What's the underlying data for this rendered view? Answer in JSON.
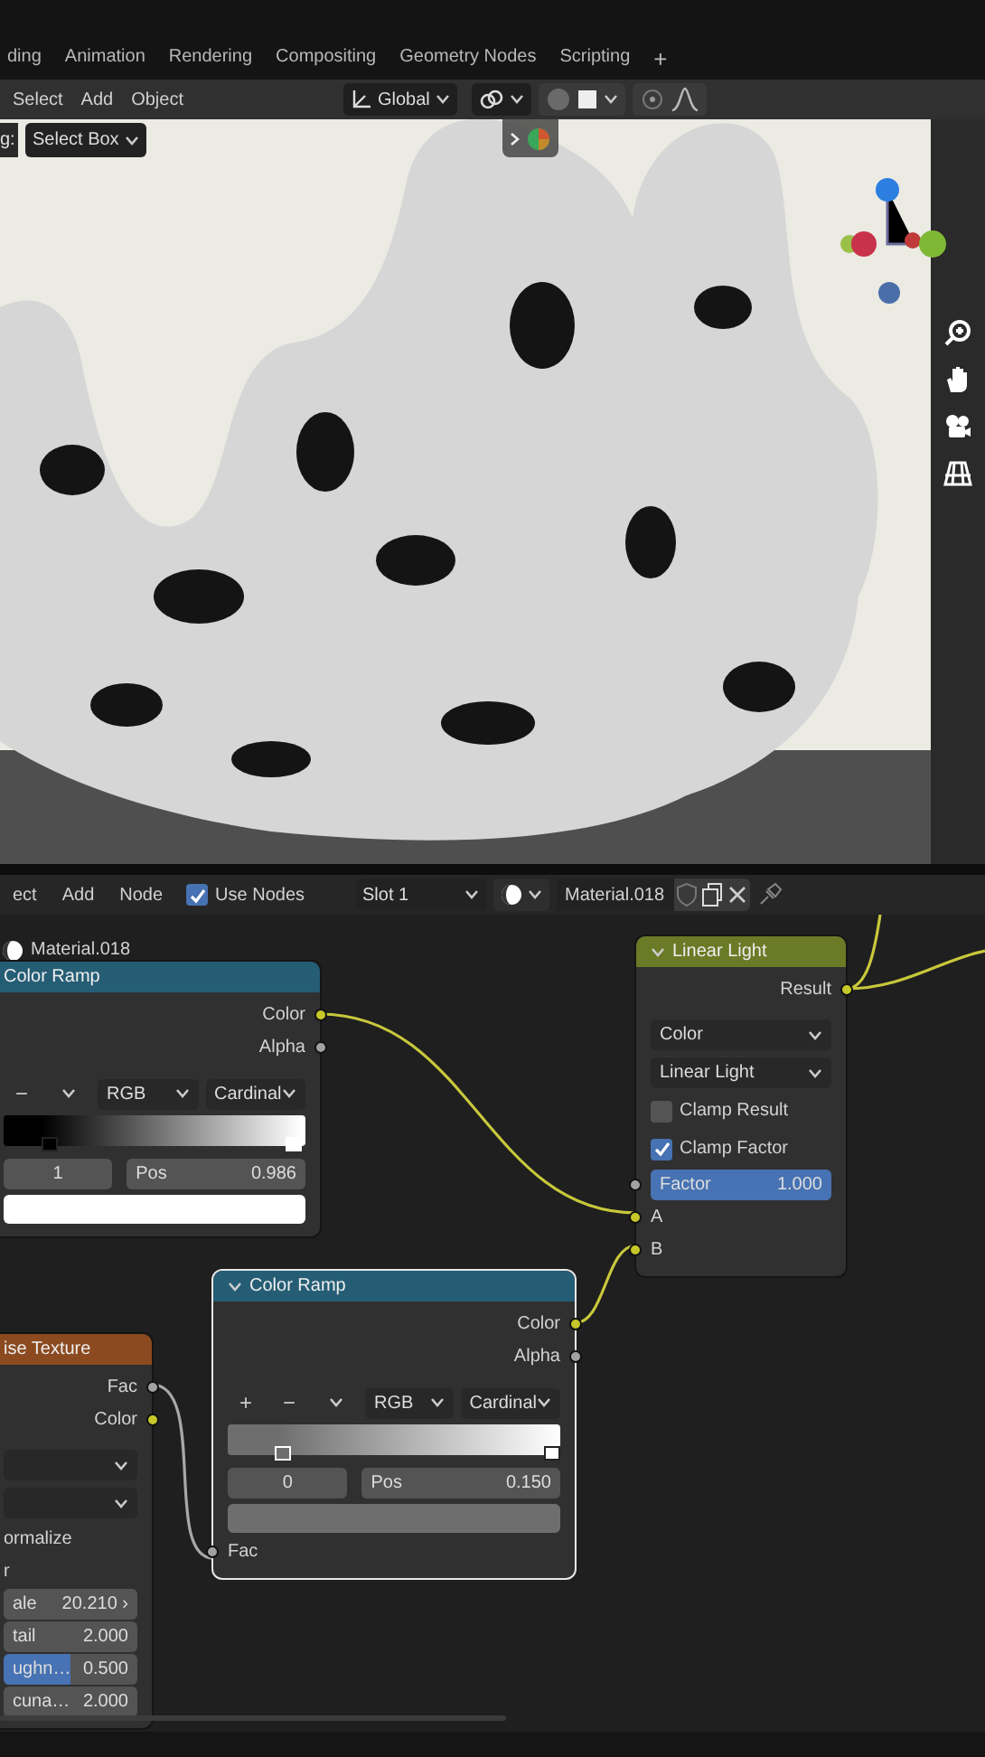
{
  "workspace_tabs": [
    {
      "label": "ding",
      "selected": false
    },
    {
      "label": "Animation",
      "selected": false
    },
    {
      "label": "Rendering",
      "selected": false
    },
    {
      "label": "Compositing",
      "selected": false
    },
    {
      "label": "Geometry Nodes",
      "selected": false
    },
    {
      "label": "Scripting",
      "selected": false
    }
  ],
  "add_tab": "+",
  "viewport": {
    "menus": [
      "Select",
      "Add",
      "Object"
    ],
    "orientation": "Global",
    "tool_label": "g:",
    "tool": "Select Box"
  },
  "node_editor": {
    "menus": [
      "ect",
      "Add",
      "Node"
    ],
    "use_nodes": {
      "label": "Use Nodes",
      "checked": true
    },
    "slot": "Slot 1",
    "material": "Material.018",
    "breadcrumb": "Material.018"
  },
  "nodes": [
    {
      "kind": "converter",
      "title": "Color Ramp",
      "rows": [
        {
          "kind": "output",
          "label": "Color",
          "color": "#c7c729"
        },
        {
          "kind": "output",
          "label": "Alpha",
          "color": "#a1a1a1"
        },
        {
          "kind": "ramp_controls",
          "signs": [
            "−"
          ],
          "mode": "RGB",
          "interpolation": "Cardinal"
        },
        {
          "kind": "ramp",
          "stops": [
            {
              "level": 0.13,
              "color": "#000000",
              "selected": false
            },
            {
              "level": 0.986,
              "color": "#ffffff",
              "selected": true
            }
          ]
        },
        {
          "kind": "stop_row",
          "index": "1",
          "label": "Pos",
          "value": "0.986"
        },
        {
          "kind": "swatch"
        }
      ]
    },
    {
      "kind": "mix",
      "title": "Linear Light",
      "expanded": true,
      "rows": [
        {
          "kind": "output",
          "label": "Result",
          "color": "#c7c729"
        },
        {
          "kind": "dropdown",
          "label": "Color"
        },
        {
          "kind": "dropdown",
          "label": "Linear Light"
        },
        {
          "kind": "checkbox",
          "label": "Clamp Result",
          "checked": false
        },
        {
          "kind": "checkbox",
          "label": "Clamp Factor",
          "checked": true
        },
        {
          "kind": "field",
          "label": "Factor",
          "value": "1.000",
          "level": 1,
          "color": "#a1a1a1"
        },
        {
          "kind": "input",
          "label": "A",
          "color": "#c7c729"
        },
        {
          "kind": "input",
          "label": "B",
          "color": "#c7c729"
        }
      ]
    },
    {
      "kind": "converter",
      "title": "Color Ramp",
      "expanded": true,
      "rows": [
        {
          "kind": "output",
          "label": "Color",
          "color": "#c7c729"
        },
        {
          "kind": "output",
          "label": "Alpha",
          "color": "#a1a1a1"
        },
        {
          "kind": "ramp_controls",
          "signs": [
            "+",
            "−"
          ],
          "mode": "RGB",
          "interpolation": "Cardinal"
        },
        {
          "kind": "ramp",
          "stops": [
            {
              "level": 0.15,
              "color": "#6e6e6e",
              "selected": true
            },
            {
              "level": 1,
              "color": "#ffffff",
              "selected": false
            }
          ]
        },
        {
          "kind": "stop_row",
          "index": "0",
          "label": "Pos",
          "value": "0.150"
        },
        {
          "kind": "swatch"
        },
        {
          "kind": "input",
          "label": "Fac",
          "color": "#a1a1a1"
        }
      ]
    },
    {
      "kind": "texture",
      "title": "ise Texture",
      "rows": [
        {
          "kind": "output",
          "label": "Fac",
          "color": "#a1a1a1"
        },
        {
          "kind": "output",
          "label": "Color",
          "color": "#c7c729"
        },
        {
          "kind": "dropdown"
        },
        {
          "kind": "dropdown"
        },
        {
          "kind": "text",
          "label": "ormalize"
        },
        {
          "kind": "text",
          "label": "r"
        },
        {
          "kind": "field",
          "label": "ale",
          "value": "20.210",
          "arrow": "›"
        },
        {
          "kind": "field",
          "label": "tail",
          "value": "2.000"
        },
        {
          "kind": "field",
          "label": "ughn…",
          "value": "0.500",
          "level": 0.5
        },
        {
          "kind": "field",
          "label": "cuna…",
          "value": "2.000"
        }
      ]
    }
  ]
}
